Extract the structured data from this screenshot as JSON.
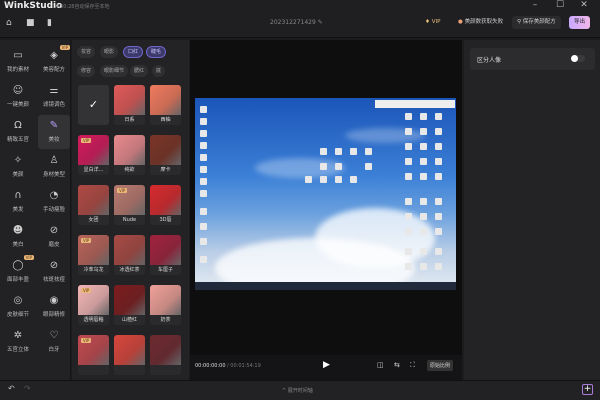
{
  "app": {
    "title": "WinkStudio",
    "autosave": "14:30:28自动保存至本地",
    "window": {
      "minimize": "–",
      "maximize": "☐",
      "close": "✕"
    }
  },
  "toolbar": {
    "project_name": "202312271429",
    "vip": "VIP",
    "beauty_status": "美颜数获取失败",
    "save_recipe": "保存美颜配方",
    "export": "导出",
    "accent": "#c9a8ff"
  },
  "nav": [
    {
      "label": "我的素材",
      "icon": "folder-icon",
      "glyph": "▭"
    },
    {
      "label": "美容配方",
      "icon": "layers-icon",
      "glyph": "◈",
      "vip": "VIP"
    },
    {
      "label": "一键美颜",
      "icon": "face-icon",
      "glyph": "☺"
    },
    {
      "label": "滤镜调色",
      "icon": "sliders-icon",
      "glyph": "⚌"
    },
    {
      "label": "精致五官",
      "icon": "portrait-icon",
      "glyph": "Ω"
    },
    {
      "label": "美妆",
      "icon": "makeup-brush-icon",
      "glyph": "✎",
      "active": true
    },
    {
      "label": "美颜",
      "icon": "magic-wand-icon",
      "glyph": "✧"
    },
    {
      "label": "身材美型",
      "icon": "body-icon",
      "glyph": "♙"
    },
    {
      "label": "美发",
      "icon": "hair-icon",
      "glyph": "∩"
    },
    {
      "label": "手动瘦脸",
      "icon": "face-slim-icon",
      "glyph": "◔"
    },
    {
      "label": "美白",
      "icon": "whitening-icon",
      "glyph": "☻"
    },
    {
      "label": "磨皮",
      "icon": "smooth-icon",
      "glyph": "⊘"
    },
    {
      "label": "面部丰盈",
      "icon": "face-fill-icon",
      "glyph": "◯",
      "vip": "VIP"
    },
    {
      "label": "祛斑祛痘",
      "icon": "blemish-icon",
      "glyph": "⊘"
    },
    {
      "label": "皮肤细节",
      "icon": "skin-icon",
      "glyph": "◎"
    },
    {
      "label": "眼部精修",
      "icon": "eye-icon",
      "glyph": "◉"
    },
    {
      "label": "五官立体",
      "icon": "contour-icon",
      "glyph": "✲"
    },
    {
      "label": "白牙",
      "icon": "tooth-icon",
      "glyph": "♡"
    }
  ],
  "chips": [
    {
      "label": "妆容"
    },
    {
      "label": "眼影"
    },
    {
      "label": "口红",
      "selected": true
    },
    {
      "label": "睫毛",
      "selected": true
    },
    {
      "label": "修容"
    },
    {
      "label": "眼影细节"
    },
    {
      "label": "腮红"
    },
    {
      "label": "底"
    }
  ],
  "lipsticks": [
    {
      "label": "",
      "none": true
    },
    {
      "label": "日系",
      "color": "#e05a58"
    },
    {
      "label": "西柚",
      "color": "#f07a5e"
    },
    {
      "label": "显白洋...",
      "color": "#d41a5c",
      "vip": "VIP"
    },
    {
      "label": "纯欲",
      "color": "#e88a8e"
    },
    {
      "label": "摩卡",
      "color": "#7a3426"
    },
    {
      "label": "女团",
      "color": "#b04a44"
    },
    {
      "label": "Nude",
      "color": "#b87a70",
      "vip": "VIP"
    },
    {
      "label": "3D唇",
      "color": "#d82a2e"
    },
    {
      "label": "冷萃乌龙",
      "color": "#b8645a",
      "vip": "VIP"
    },
    {
      "label": "冰透红茶",
      "color": "#a84a44"
    },
    {
      "label": "车厘子",
      "color": "#a0223e"
    },
    {
      "label": "透明唇釉",
      "color": "#f3b6b6",
      "vip": "VIP"
    },
    {
      "label": "山楂红",
      "color": "#7c1c1e"
    },
    {
      "label": "奶茶",
      "color": "#eea098"
    },
    {
      "label": "",
      "color": "#c24a50",
      "vip": "VIP"
    },
    {
      "label": "",
      "color": "#d8463c"
    },
    {
      "label": "",
      "color": "#6e2a30"
    }
  ],
  "player": {
    "current": "00:00:00:00",
    "total": "/ 00:01:54:19",
    "ratio": "原始比例"
  },
  "right_panel": {
    "label": "区分人像",
    "toggle_on": false
  },
  "bottom": {
    "timeline": "展开时间轴",
    "add": "+"
  }
}
